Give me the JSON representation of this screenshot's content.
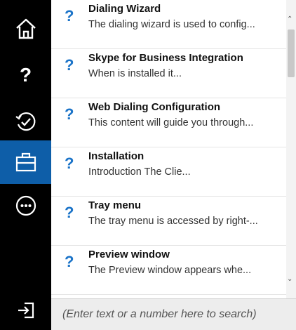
{
  "sidebar": {
    "items": [
      {
        "icon": "home-icon"
      },
      {
        "icon": "question-icon",
        "label": "?"
      },
      {
        "icon": "history-check-icon"
      },
      {
        "icon": "briefcase-icon",
        "active": true
      },
      {
        "icon": "more-icon"
      }
    ],
    "bottom_icon": "sign-in-icon"
  },
  "results": [
    {
      "icon": "?",
      "title": "Dialing Wizard",
      "desc": "The dialing wizard is used to config..."
    },
    {
      "icon": "?",
      "title": "Skype for Business Integration",
      "desc": "When  is installed it..."
    },
    {
      "icon": "?",
      "title": "Web Dialing Configuration",
      "desc": "This content will guide you through..."
    },
    {
      "icon": "?",
      "title": "Installation",
      "desc": "Introduction The Clie..."
    },
    {
      "icon": "?",
      "title": "Tray menu",
      "desc": "The tray menu is accessed by right-..."
    },
    {
      "icon": "?",
      "title": "Preview window",
      "desc": "The Preview window appears whe..."
    }
  ],
  "search": {
    "placeholder": "(Enter text or a number here to search)"
  },
  "colors": {
    "sidebar_bg": "#000000",
    "active_bg": "#0e5ea8",
    "question_icon": "#1a73c8",
    "search_bg": "#ededed"
  }
}
